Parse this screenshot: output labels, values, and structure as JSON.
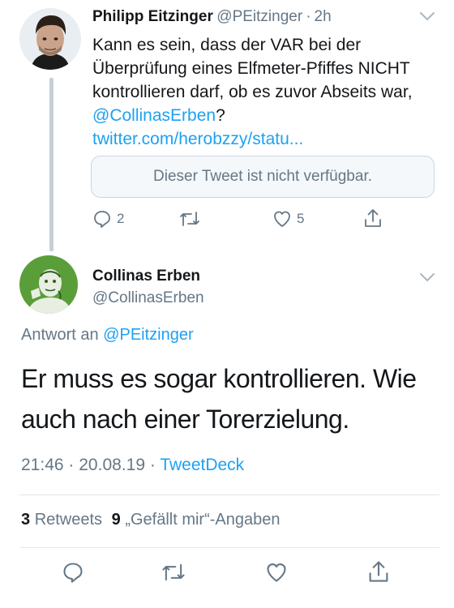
{
  "tweet1": {
    "author_name": "Philipp Eitzinger",
    "author_handle": "@PEitzinger",
    "separator": "·",
    "time": "2h",
    "text_before": "Kann es sein, dass der VAR bei der Überprüfung eines Elfmeter-Pfiffes NICHT kontrollieren darf, ob es zuvor Abseits war, ",
    "mention": "@CollinasErben",
    "text_after": "?",
    "link": "twitter.com/herobzzy/statu...",
    "unavailable_notice": "Dieser Tweet ist nicht verfügbar.",
    "actions": {
      "reply_count": "2",
      "retweet_count": "",
      "like_count": "5"
    }
  },
  "tweet2": {
    "author_name": "Collinas Erben",
    "author_handle": "@CollinasErben",
    "reply_prefix": "Antwort an",
    "reply_to": "@PEitzinger",
    "text": "Er muss es sogar kontrollieren. Wie auch nach einer Torerzielung.",
    "time": "21:46",
    "date": "20.08.19",
    "separator": "·",
    "source": "TweetDeck",
    "retweets_count": "3",
    "retweets_label": "Retweets",
    "likes_count": "9",
    "likes_label": "„Gefällt mir“-Angaben"
  },
  "icons": {
    "reply": "reply-icon",
    "retweet": "retweet-icon",
    "like": "heart-icon",
    "share": "share-icon",
    "more": "chevron-down-icon"
  },
  "colors": {
    "link": "#1da1f2",
    "secondary": "#657786",
    "avatar2_bg": "#5a9e3a"
  }
}
